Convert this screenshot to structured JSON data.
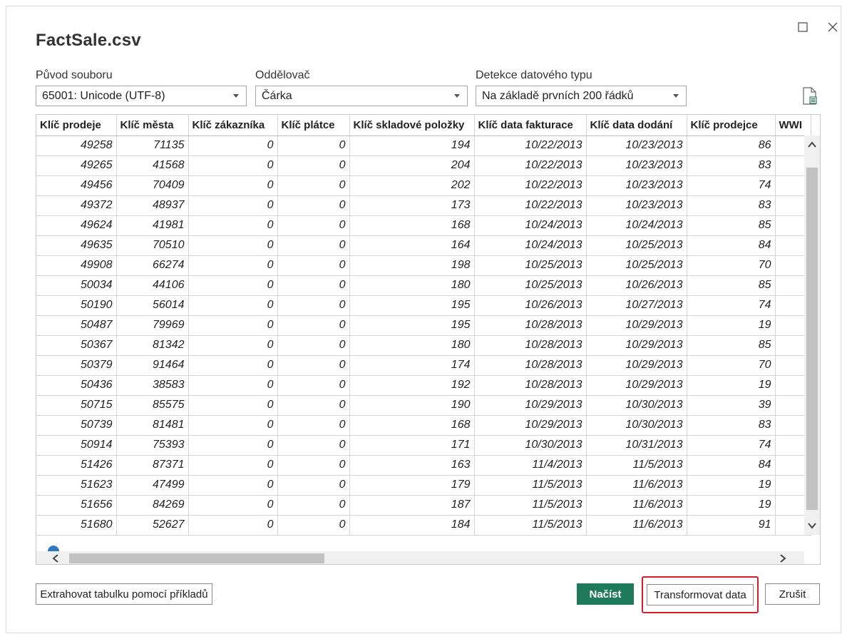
{
  "dialog": {
    "title": "FactSale.csv",
    "file_origin": {
      "label": "Původ souboru",
      "value": "65001: Unicode (UTF-8)"
    },
    "delimiter": {
      "label": "Oddělovač",
      "value": "Čárka"
    },
    "type_detection": {
      "label": "Detekce datového typu",
      "value": "Na základě prvních 200 řádků"
    }
  },
  "table": {
    "columns": [
      "Klíč prodeje",
      "Klíč města",
      "Klíč zákazníka",
      "Klíč plátce",
      "Klíč skladové položky",
      "Klíč data fakturace",
      "Klíč data dodání",
      "Klíč prodejce",
      "WWI"
    ],
    "rows": [
      [
        "49258",
        "71135",
        "0",
        "0",
        "194",
        "10/22/2013",
        "10/23/2013",
        "86"
      ],
      [
        "49265",
        "41568",
        "0",
        "0",
        "204",
        "10/22/2013",
        "10/23/2013",
        "83"
      ],
      [
        "49456",
        "70409",
        "0",
        "0",
        "202",
        "10/22/2013",
        "10/23/2013",
        "74"
      ],
      [
        "49372",
        "48937",
        "0",
        "0",
        "173",
        "10/22/2013",
        "10/23/2013",
        "83"
      ],
      [
        "49624",
        "41981",
        "0",
        "0",
        "168",
        "10/24/2013",
        "10/24/2013",
        "85"
      ],
      [
        "49635",
        "70510",
        "0",
        "0",
        "164",
        "10/24/2013",
        "10/25/2013",
        "84"
      ],
      [
        "49908",
        "66274",
        "0",
        "0",
        "198",
        "10/25/2013",
        "10/25/2013",
        "70"
      ],
      [
        "50034",
        "44106",
        "0",
        "0",
        "180",
        "10/25/2013",
        "10/26/2013",
        "85"
      ],
      [
        "50190",
        "56014",
        "0",
        "0",
        "195",
        "10/26/2013",
        "10/27/2013",
        "74"
      ],
      [
        "50487",
        "79969",
        "0",
        "0",
        "195",
        "10/28/2013",
        "10/29/2013",
        "19"
      ],
      [
        "50367",
        "81342",
        "0",
        "0",
        "180",
        "10/28/2013",
        "10/29/2013",
        "85"
      ],
      [
        "50379",
        "91464",
        "0",
        "0",
        "174",
        "10/28/2013",
        "10/29/2013",
        "70"
      ],
      [
        "50436",
        "38583",
        "0",
        "0",
        "192",
        "10/28/2013",
        "10/29/2013",
        "19"
      ],
      [
        "50715",
        "85575",
        "0",
        "0",
        "190",
        "10/29/2013",
        "10/30/2013",
        "39"
      ],
      [
        "50739",
        "81481",
        "0",
        "0",
        "168",
        "10/29/2013",
        "10/30/2013",
        "83"
      ],
      [
        "50914",
        "75393",
        "0",
        "0",
        "171",
        "10/30/2013",
        "10/31/2013",
        "74"
      ],
      [
        "51426",
        "87371",
        "0",
        "0",
        "163",
        "11/4/2013",
        "11/5/2013",
        "84"
      ],
      [
        "51623",
        "47499",
        "0",
        "0",
        "179",
        "11/5/2013",
        "11/6/2013",
        "19"
      ],
      [
        "51656",
        "84269",
        "0",
        "0",
        "187",
        "11/5/2013",
        "11/6/2013",
        "19"
      ],
      [
        "51680",
        "52627",
        "0",
        "0",
        "184",
        "11/5/2013",
        "11/6/2013",
        "91"
      ]
    ]
  },
  "buttons": {
    "extract": "Extrahovat tabulku pomocí příkladů",
    "load": "Načíst",
    "transform": "Transformovat data",
    "cancel": "Zrušit"
  },
  "colors": {
    "load_button": "#1f7a5c",
    "highlight": "#d21f2a"
  },
  "icons": {
    "maximize": "maximize-icon",
    "close": "close-icon",
    "file": "file-settings-icon"
  }
}
